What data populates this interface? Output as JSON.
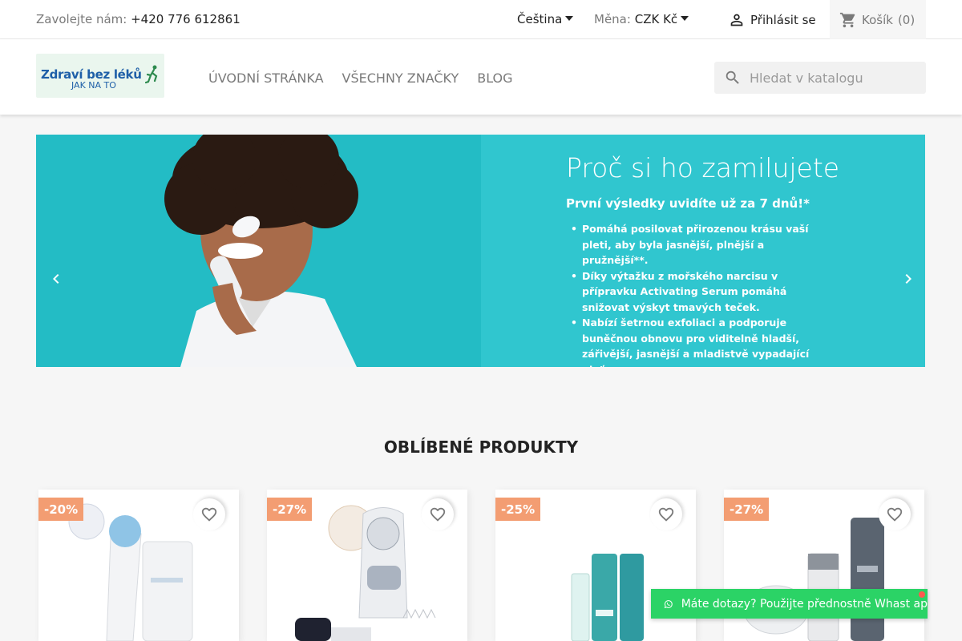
{
  "topbar": {
    "contact_label": "Zavolejte nám:",
    "phone": "+420 776 612861",
    "language": "Čeština",
    "currency_label": "Měna:",
    "currency_value": "CZK Kč",
    "signin": "Přihlásit se",
    "cart_label": "Košík",
    "cart_count": "(0)"
  },
  "header": {
    "logo_line1": "Zdraví bez léků",
    "logo_line2": "JAK NA TO",
    "nav": [
      "Úvodní stránka",
      "Všechny značky",
      "Blog"
    ],
    "search_placeholder": "Hledat v katalogu"
  },
  "slider": {
    "title": "Proč si ho zamilujete",
    "subtitle": "První výsledky uvidíte už za 7 dnů!*",
    "bullets": [
      "Pomáhá posilovat přirozenou krásu vaší pleti, aby byla jasnější, plnější a pružnější**.",
      "Díky výtažku z mořského narcisu v přípravku Activating Serum pomáhá snižovat výskyt tmavých teček.",
      "Nabízí šetrnou exfoliaci a podporuje buněčnou obnovu pro viditelně hladší, zářivější, jasnější a mladistvě vypadající pleť."
    ]
  },
  "featured": {
    "title": "Oblíbené produkty",
    "products": [
      {
        "discount": "-20%"
      },
      {
        "discount": "-27%"
      },
      {
        "discount": "-25%"
      },
      {
        "discount": "-27%"
      }
    ]
  },
  "whatsapp": {
    "text": "Máte dotazy? Použijte přednostně Whast ap"
  }
}
